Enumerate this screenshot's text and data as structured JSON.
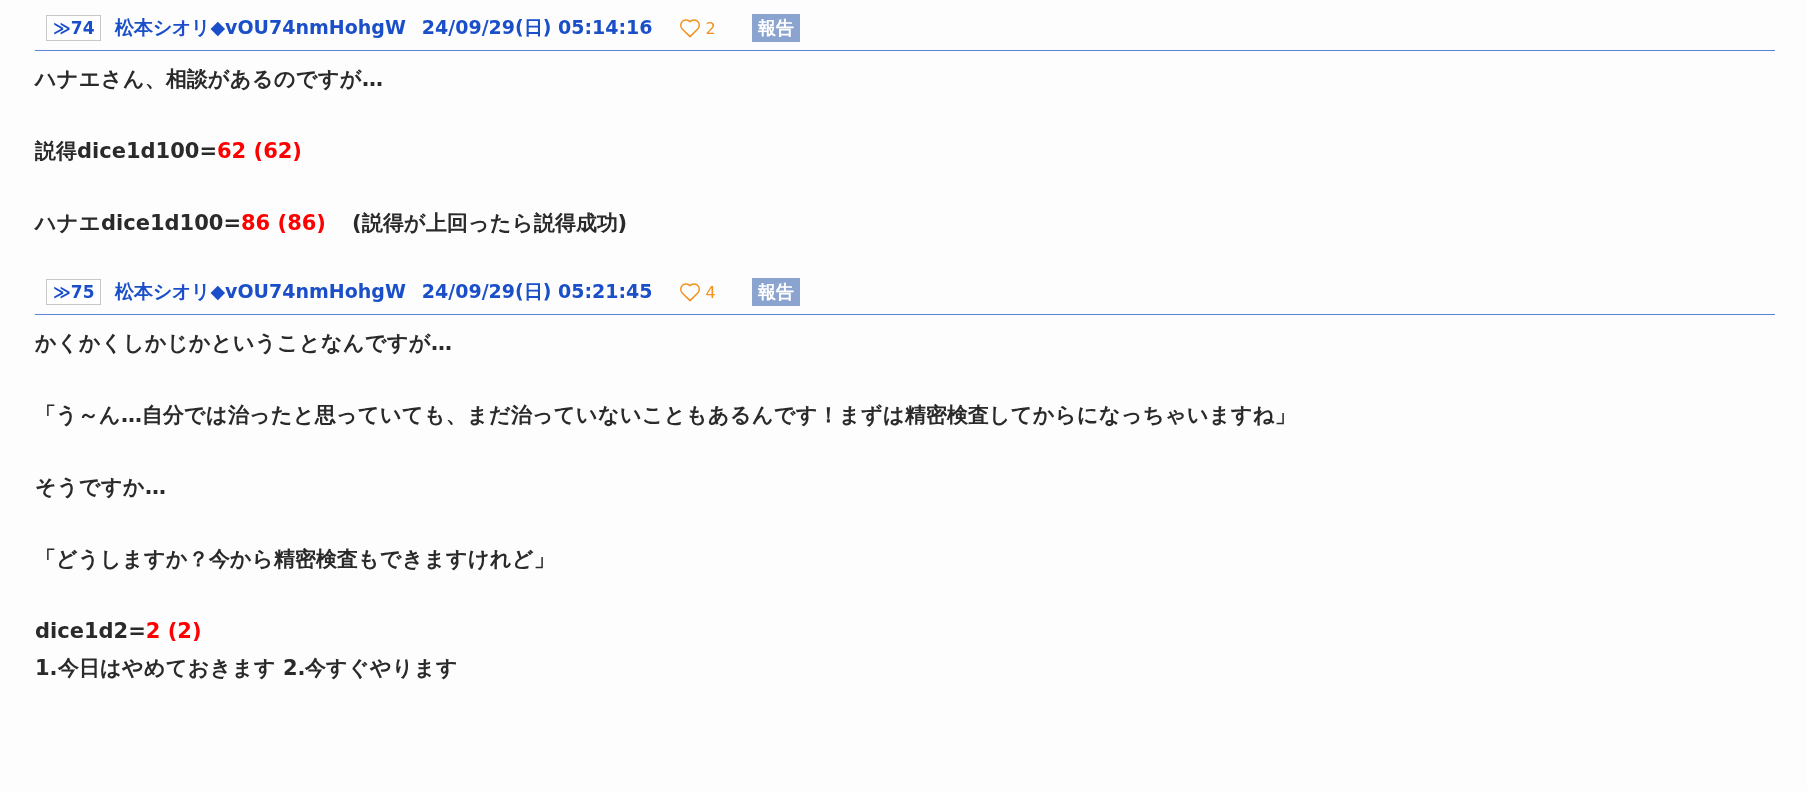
{
  "posts": [
    {
      "number": "≫74",
      "name": "松本シオリ◆vOU74nmHohgW",
      "date": "24/09/29(日) 05:14:16",
      "likes": "2",
      "report": "報告",
      "paragraphs": [
        {
          "lines": [
            [
              {
                "kind": "text",
                "text": "ハナエさん、相談があるのですが…"
              }
            ]
          ]
        },
        {
          "lines": [
            [
              {
                "kind": "text",
                "text": "説得dice1d100="
              },
              {
                "kind": "dice",
                "text": "62 (62)"
              }
            ]
          ]
        },
        {
          "lines": [
            [
              {
                "kind": "text",
                "text": "ハナエdice1d100="
              },
              {
                "kind": "dice",
                "text": "86 (86)"
              },
              {
                "kind": "note",
                "text": "(説得が上回ったら説得成功)"
              }
            ]
          ]
        }
      ]
    },
    {
      "number": "≫75",
      "name": "松本シオリ◆vOU74nmHohgW",
      "date": "24/09/29(日) 05:21:45",
      "likes": "4",
      "report": "報告",
      "paragraphs": [
        {
          "lines": [
            [
              {
                "kind": "text",
                "text": "かくかくしかじかということなんですが…"
              }
            ]
          ]
        },
        {
          "lines": [
            [
              {
                "kind": "text",
                "text": "「う～ん…自分では治ったと思っていても、まだ治っていないこともあるんです！まずは精密検査してからになっちゃいますね」"
              }
            ]
          ]
        },
        {
          "lines": [
            [
              {
                "kind": "text",
                "text": "そうですか…"
              }
            ]
          ]
        },
        {
          "lines": [
            [
              {
                "kind": "text",
                "text": "「どうしますか？今から精密検査もできますけれど」"
              }
            ]
          ]
        },
        {
          "lines": [
            [
              {
                "kind": "text",
                "text": "dice1d2="
              },
              {
                "kind": "dice",
                "text": "2 (2)"
              }
            ],
            [
              {
                "kind": "text",
                "text": "1.今日はやめておきます 2.今すぐやります"
              }
            ]
          ]
        }
      ]
    }
  ]
}
